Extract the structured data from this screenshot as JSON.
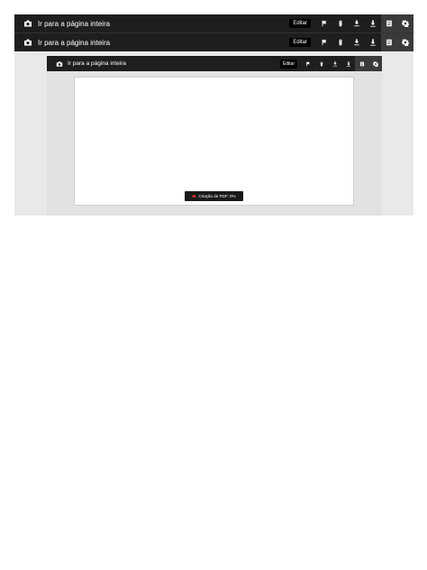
{
  "toolbar_rows": [
    {
      "title": "Ir para a página inteira",
      "edit_label": "Editar"
    },
    {
      "title": "Ir para a página inteira",
      "edit_label": "Editar"
    }
  ],
  "preview": {
    "title": "Ir para a página inteira",
    "edit_label": "Editar",
    "status_text": "Criação de PDF: 0%",
    "status_color": "#e0352b"
  },
  "icons": [
    "camera-icon",
    "flag-icon",
    "trash-icon",
    "download-pdf-icon",
    "download-icon",
    "page-icon",
    "gear-icon"
  ]
}
